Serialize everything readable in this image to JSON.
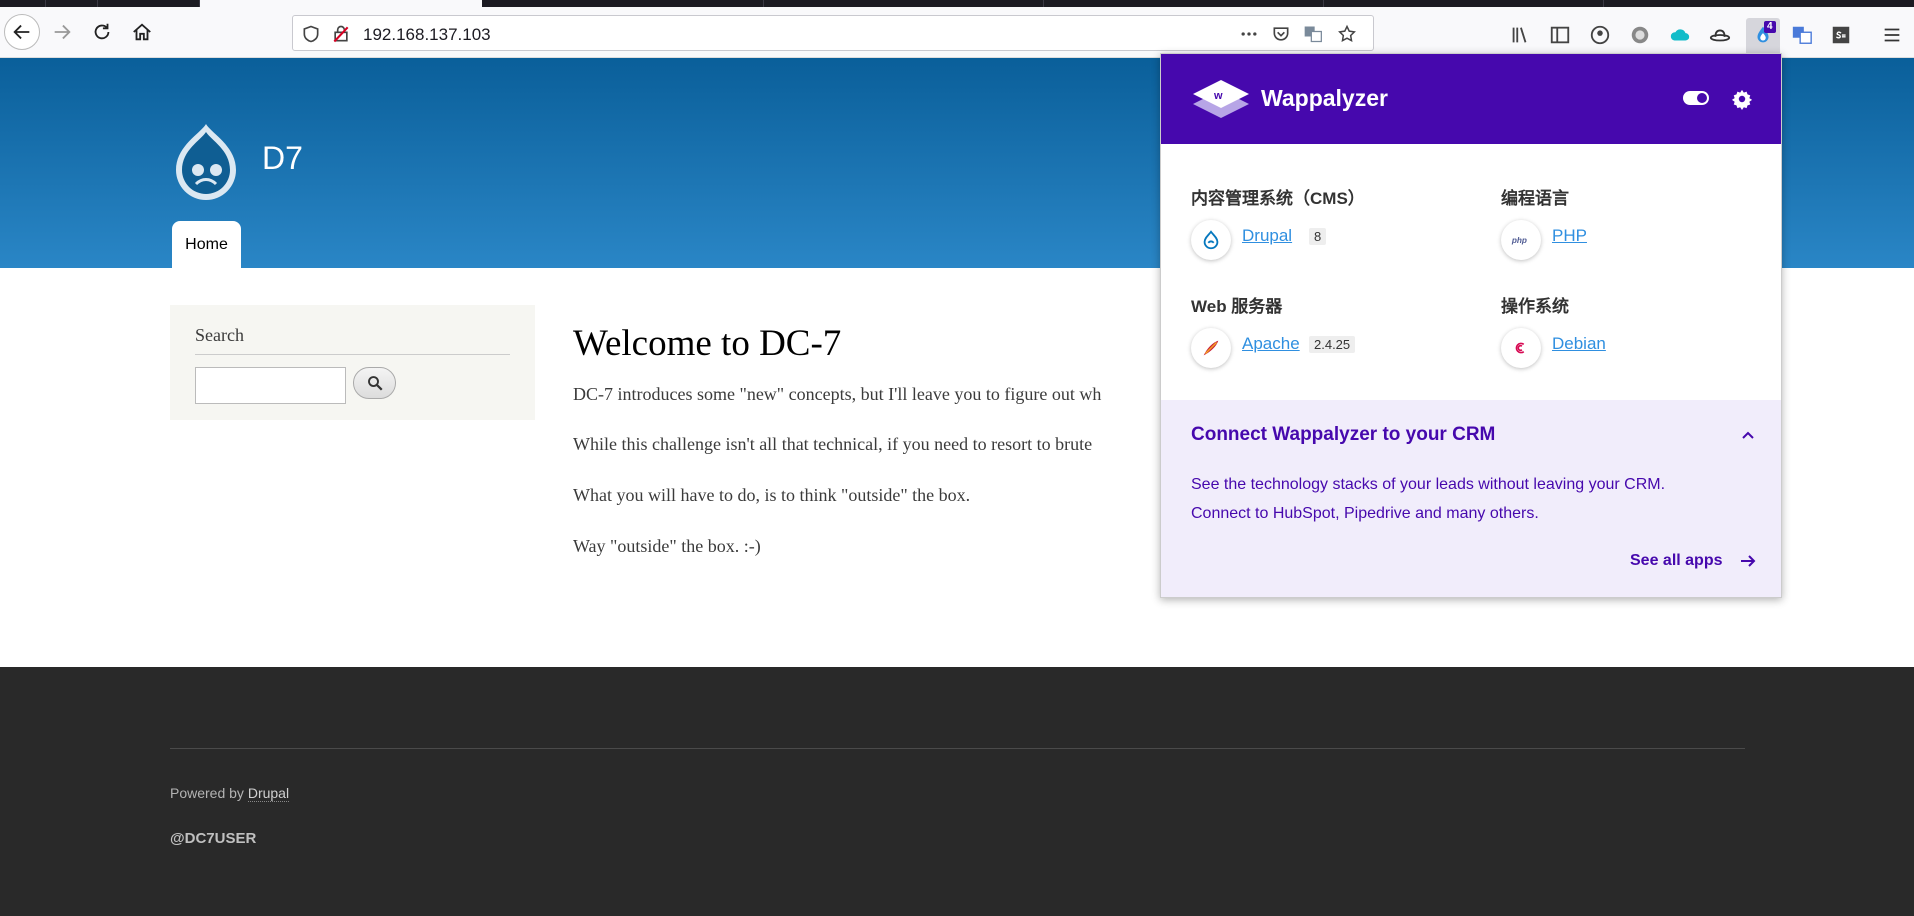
{
  "browser": {
    "url": "192.168.137.103",
    "extension_badge": "4"
  },
  "site": {
    "name": "D7",
    "nav_home": "Home",
    "search_title": "Search",
    "welcome_title": "Welcome to DC-7",
    "paragraphs": [
      "DC-7 introduces some \"new\" concepts, but I'll leave you to figure out wh",
      "While this challenge isn't all that technical, if you need to resort to brute",
      "What you will have to do, is to think \"outside\" the box.",
      "Way \"outside\" the box.  :-)"
    ],
    "footer_powered": "Powered by",
    "footer_drupal": "Drupal",
    "footer_user": "@DC7USER"
  },
  "wappalyzer": {
    "title": "Wappalyzer",
    "categories": [
      {
        "label": "内容管理系统（CMS）",
        "tech": "Drupal",
        "version": "8",
        "icon": "drupal-icon"
      },
      {
        "label": "编程语言",
        "tech": "PHP",
        "version": "",
        "icon": "php-icon"
      },
      {
        "label": "Web 服务器",
        "tech": "Apache",
        "version": "2.4.25",
        "icon": "apache-icon"
      },
      {
        "label": "操作系统",
        "tech": "Debian",
        "version": "",
        "icon": "debian-icon"
      }
    ],
    "crm": {
      "title": "Connect Wappalyzer to your CRM",
      "text": "See the technology stacks of your leads without leaving your CRM. Connect to HubSpot, Pipedrive and many others.",
      "link": "See all apps"
    }
  },
  "colors": {
    "wappalyzer_purple": "#4608ad",
    "header_blue": "#0a5f9a",
    "footer_dark": "#292929",
    "link_blue": "#2f8fe0"
  }
}
